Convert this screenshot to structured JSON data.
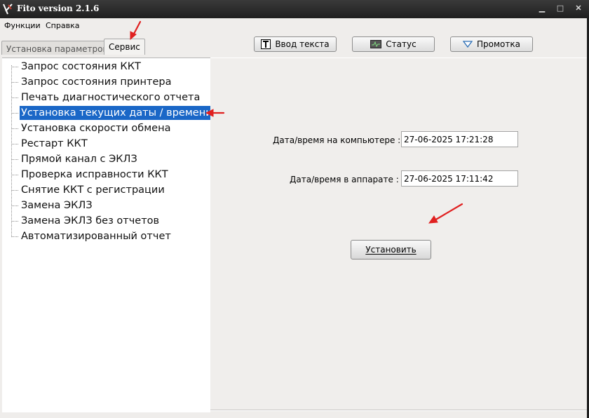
{
  "window": {
    "title": "Fito version 2.1.6"
  },
  "menu": [
    "Функции",
    "Справка"
  ],
  "tabs": [
    {
      "label": "Установка параметров",
      "active": false
    },
    {
      "label": "Сервис",
      "active": true
    }
  ],
  "toolbar": {
    "text_input": "Ввод текста",
    "status": "Статус",
    "scroll": "Промотка"
  },
  "tree": [
    "Запрос состояния ККТ",
    "Запрос состояния принтера",
    "Печать диагностического отчета",
    "Установка текущих даты / времени",
    "Установка скорости обмена",
    "Рестарт ККТ",
    "Прямой канал с ЭКЛЗ",
    "Проверка исправности ККТ",
    "Снятие ККТ с регистрации",
    "Замена ЭКЛЗ",
    "Замена ЭКЛЗ без отчетов",
    "Автоматизированный отчет"
  ],
  "selected_index": 3,
  "form": {
    "computer_label": "Дата/время на компьютере :",
    "computer_value": "27-06-2025 17:21:28",
    "device_label": "Дата/время в аппарате :",
    "device_value": "27-06-2025 17:11:42",
    "set_button": "Установить"
  },
  "colors": {
    "selection": "#1a67c7",
    "annotation_arrow": "#e02020"
  }
}
